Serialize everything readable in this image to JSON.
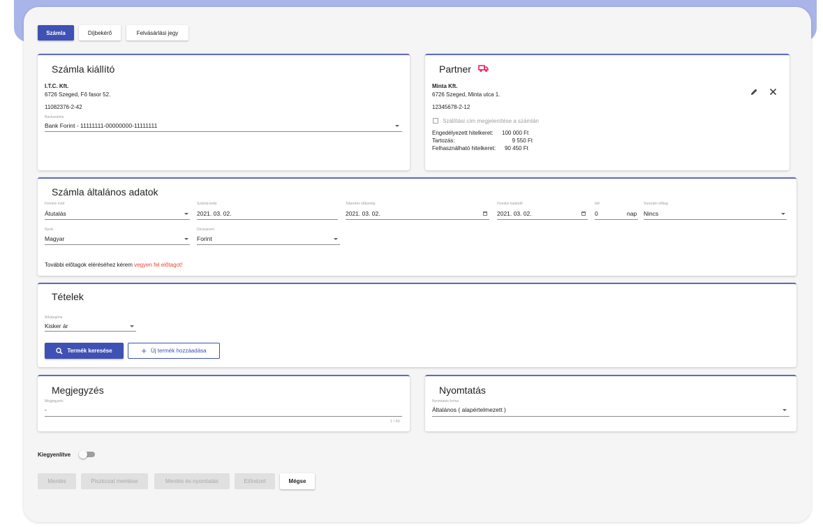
{
  "tabs": {
    "invoice": "Számla",
    "fee_request": "Díjbekérő",
    "purchase_ticket": "Felvásárlási jegy"
  },
  "issuer": {
    "title": "Számla kiállító",
    "company": "I.T.C. Kft.",
    "address": "6726 Szeged, Fő fasor 52.",
    "tax_number": "11082376-2-42",
    "bank_label": "Bankszámla",
    "bank_value": "Bank Forint - 11111111-00000000-11111111"
  },
  "partner": {
    "title": "Partner",
    "company": "Minta Kft.",
    "address": "6726 Szeged, Minta utca 1.",
    "tax_number": "12345678-2-12",
    "shipping_checkbox": "Szállítási cím megjelenítése a számlán",
    "credit_limit_label": "Engedélyezett hitelkeret:",
    "credit_limit_value": "100 000 Ft",
    "debt_label": "Tartozás:",
    "debt_value": "9 550 Ft",
    "available_label": "Felhasználható hitelkeret:",
    "available_value": "90 450 Ft"
  },
  "general": {
    "title": "Számla általános adatok",
    "payment_method_label": "Fizetési mód",
    "payment_method_value": "Átutalás",
    "issue_date_label": "Számla kelte",
    "issue_date_value": "2021. 03. 02.",
    "performance_date_label": "Teljesítés időpontja",
    "performance_date_value": "2021. 03. 02.",
    "due_date_label": "Fizetési határidő",
    "due_date_value": "2021. 03. 02.",
    "time_label": "Idő",
    "time_value": "0",
    "time_unit": "nap",
    "prefix_label": "Sorszám előtag",
    "prefix_value": "Nincs",
    "language_label": "Nyelv",
    "language_value": "Magyar",
    "currency_label": "Devizanem",
    "currency_value": "Forint",
    "notice_text": "További előtagok eléréséhez kérem ",
    "notice_link": "vegyen fel előtagot!"
  },
  "items": {
    "title": "Tételek",
    "price_category_label": "Árkategória",
    "price_category_value": "Kisker ár",
    "search_button": "Termék keresése",
    "add_button": "Új termék hozzáadása"
  },
  "note": {
    "title": "Megjegyzés",
    "field_label": "Megjegyzés",
    "value": "-",
    "counter": "1 / 40"
  },
  "print": {
    "title": "Nyomtatás",
    "form_label": "Nyomtatás forma",
    "form_value": "Általános ( alapértelmezett )"
  },
  "settled": {
    "label": "Kiegyenlítve"
  },
  "actions": {
    "save": "Mentés",
    "draft": "Piszkozat mentése",
    "save_print": "Mentés és nyomtatás",
    "preview": "Előnézet",
    "cancel": "Mégse"
  },
  "colors": {
    "primary": "#3f51b5",
    "accent_red": "#f44336",
    "truck": "#e91e63"
  }
}
